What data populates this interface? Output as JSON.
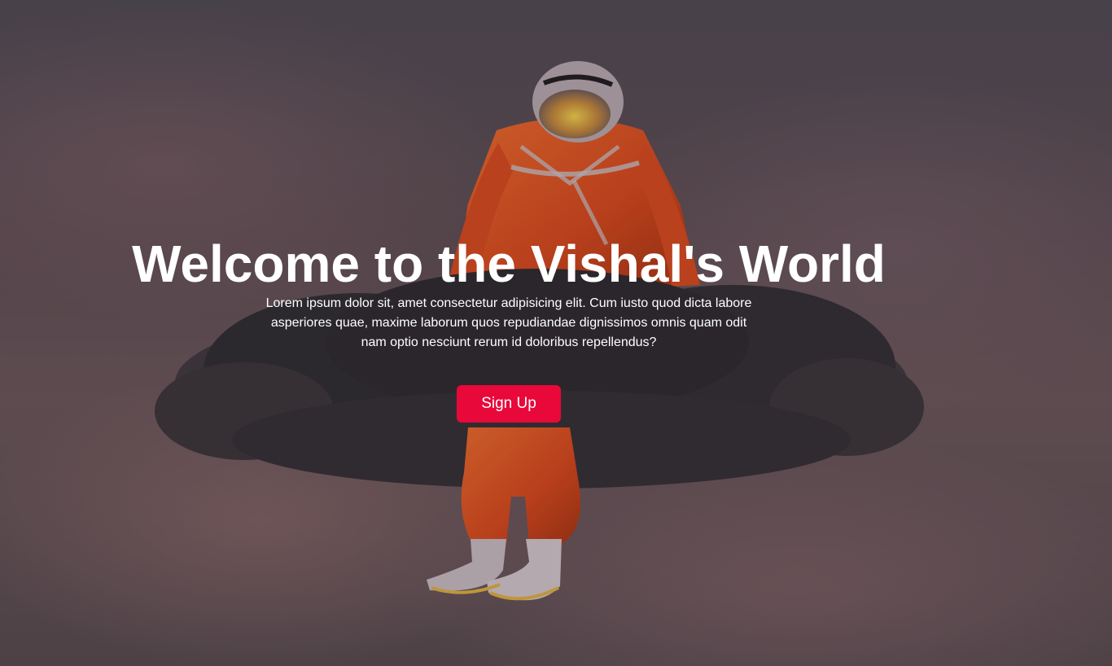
{
  "hero": {
    "title": "Welcome to the Vishal's World",
    "subtitle": "Lorem ipsum dolor sit, amet consectetur adipisicing elit. Cum iusto quod dicta labore asperiores quae, maxime laborum quos repudiandae dignissimos omnis quam odit nam optio nesciunt rerum id doloribus repellendus?",
    "cta_label": "Sign Up",
    "background_image": "astronaut-on-cloud",
    "colors": {
      "cta_background": "#e8083a",
      "cta_text": "#ffffff",
      "title_text": "#ffffff",
      "suit": "#e0501a",
      "cloud": "#2a2628"
    }
  }
}
